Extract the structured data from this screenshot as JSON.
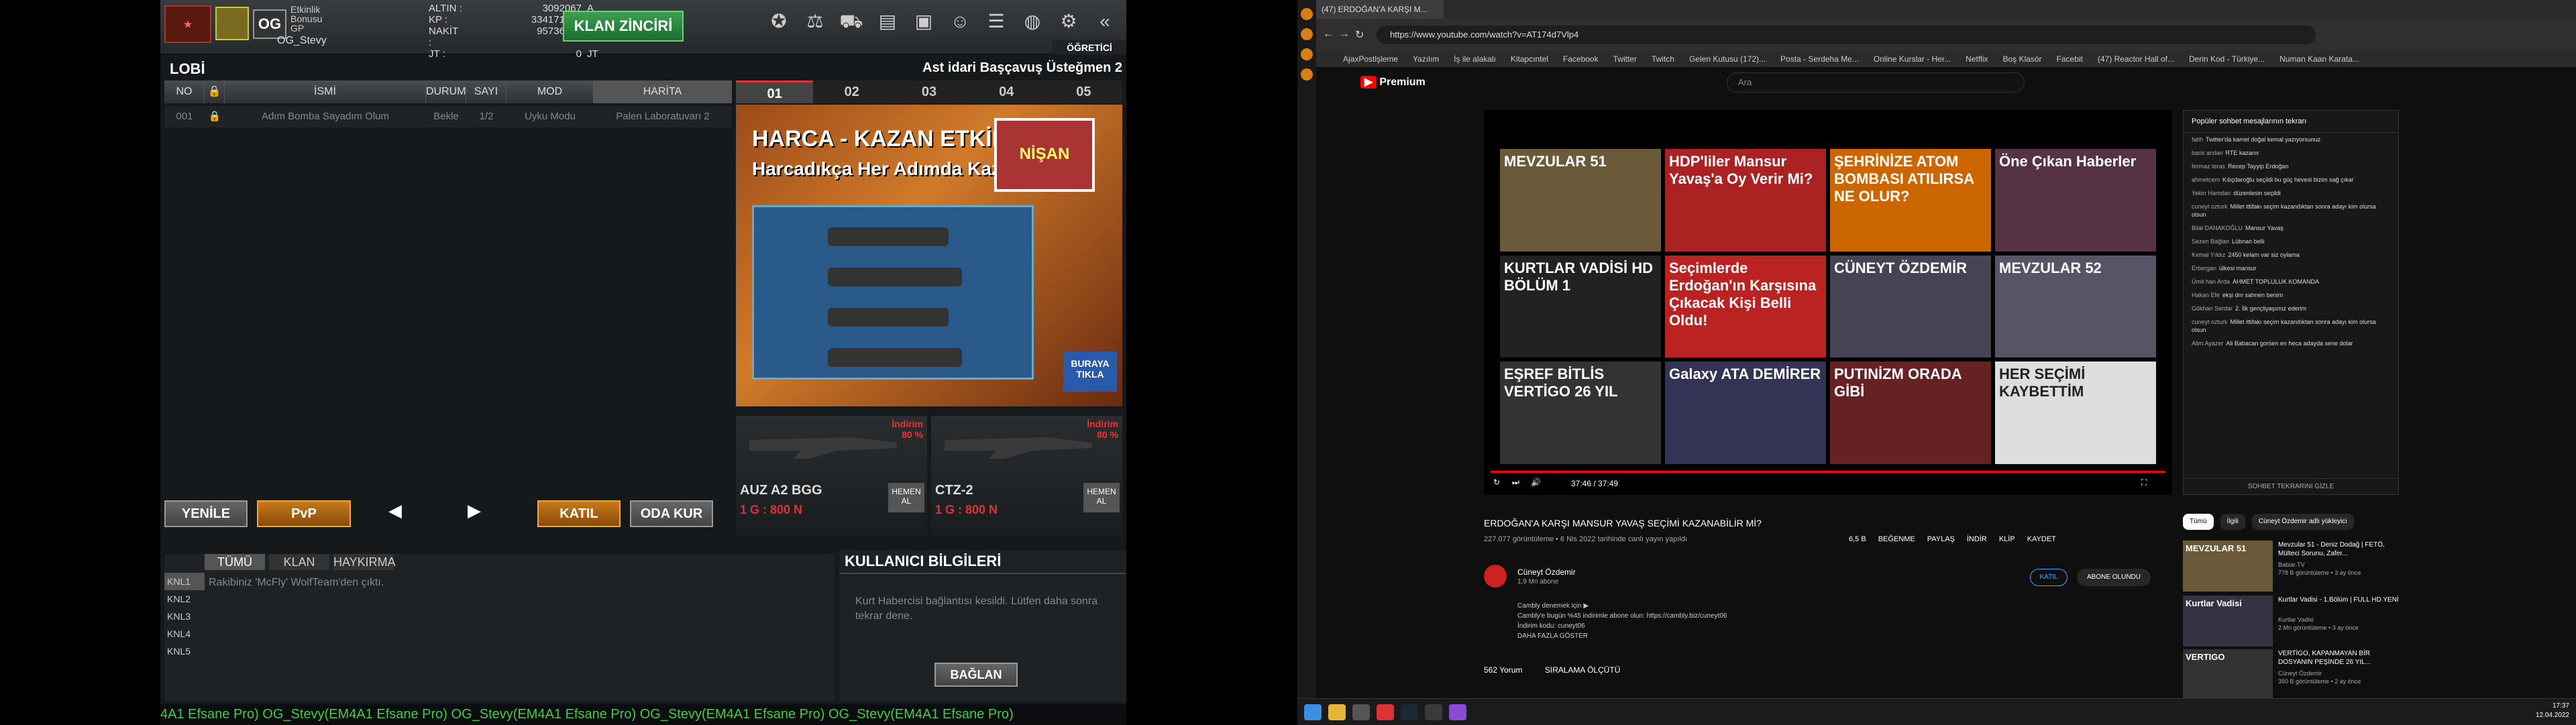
{
  "game": {
    "labels": {
      "etkinlik": "Etkinlik",
      "bonusu": "Bonusu",
      "gp": "GP"
    },
    "username": "OG_Stevy",
    "clan_tag": "OG",
    "stats": [
      {
        "k": "ALTIN :",
        "v": "3092067",
        "s": "A"
      },
      {
        "k": "KP :",
        "v": "334171579",
        "s": "KP"
      },
      {
        "k": "NAKİT :",
        "v": "95736702",
        "s": "N"
      },
      {
        "k": "JT :",
        "v": "0",
        "s": "JT"
      }
    ],
    "klan_button": "KLAN ZİNCİRİ",
    "ogretici": "ÖĞRETİCİ",
    "lobi": "LOBİ",
    "rank_name": "Ast idari Başçavuş Üsteğmen 2",
    "columns": [
      "NO",
      "",
      "İSMİ",
      "DURUM",
      "SAYI",
      "MOD",
      "HARİTA"
    ],
    "room": {
      "no": "001",
      "name": "Adım Bomba Sayadım Olum",
      "status": "Bekle",
      "count": "1/2",
      "mode": "Uyku Modu",
      "map": "Palen Laboratuvarı 2"
    },
    "tabs": [
      "01",
      "02",
      "03",
      "04",
      "05"
    ],
    "banner": {
      "title": "HARCA - KAZAN ETKİNLİĞİ",
      "subtitle": "Harcadıkça Her Adımda Kazan!",
      "badge": "NİŞAN",
      "tikla": "BURAYA TIKLA"
    },
    "weapons": [
      {
        "name": "AUZ A2 BGG",
        "price": "1 G : 800 N",
        "disc": "İndirim\n80 %",
        "hem": "HEMEN AL"
      },
      {
        "name": "CTZ-2",
        "price": "1 G : 800 N",
        "disc": "İndirim\n80 %",
        "hem": "HEMEN AL"
      }
    ],
    "buttons": {
      "yenile": "YENİLE",
      "pvp": "PvP",
      "katil": "KATIL",
      "oda": "ODA KUR"
    },
    "chat_tabs": [
      "TÜMÜ",
      "KLAN",
      "HAYKIRMA"
    ],
    "channels": [
      "KNL1",
      "KNL2",
      "KNL3",
      "KNL4",
      "KNL5"
    ],
    "chat_message": "Rakibiniz 'McFly' WolfTeam'den çıktı.",
    "userinfo": {
      "title": "KULLANICI BİLGİLERİ",
      "text": "Kurt Habercisi bağlantısı kesildi. Lütfen daha sonra tekrar dene.",
      "button": "BAĞLAN"
    },
    "ticker": "4A1 Efsane Pro)        OG_Stevy(EM4A1 Efsane Pro)        OG_Stevy(EM4A1 Efsane Pro)        OG_Stevy(EM4A1 Efsane Pro)        OG_Stevy(EM4A1 Efsane Pro)"
  },
  "browser": {
    "tab_title": "(47) ERDOĞAN'A KARŞI M...",
    "url": "https://www.youtube.com/watch?v=AT174d7Vlp4",
    "bookmarks": [
      "AjaxPostlşleme",
      "Yazılım",
      "İş ile alakalı",
      "Kitapcıntel",
      "Facebook",
      "Twitter",
      "Twitch",
      "Gelen Kutusu (172)...",
      "Posta - Serdeha Me...",
      "Online Kurslar - Her...",
      "Netflix",
      "Boş Klasör",
      "Facebit",
      "(47) Reactor Hall of...",
      "Derin Kod - Türkiye...",
      "Numan Kaan Karata..."
    ],
    "search_placeholder": "Ara",
    "logo": "Premium",
    "thumbs": [
      "MEVZULAR 51",
      "HDP'liler Mansur Yavaş'a Oy Verir Mi?",
      "ŞEHRİNİZE ATOM BOMBASI ATILIRSA NE OLUR?",
      "Öne Çıkan Haberler",
      "KURTLAR VADİSİ HD BÖLÜM 1",
      "Seçimlerde Erdoğan'ın Karşısına Çıkacak Kişi Belli Oldu!",
      "CÜNEYT ÖZDEMİR",
      "MEVZULAR 52",
      "EŞREF BİTLİS VERTİGO 26 YIL",
      "Galaxy ATA DEMİRER",
      "PUTINİZM ORADA GİBİ",
      "HER SEÇİMİ KAYBETTİM"
    ],
    "time": "37:46 / 37:49",
    "video_title": "ERDOĞAN'A KARŞI MANSUR YAVAŞ SEÇİMİ KAZANABİLİR Mİ?",
    "video_meta": "227.077 görüntüleme • 6 Nis 2022 tarihinde canlı yayın yapıldı",
    "actions": [
      "6,5 B",
      "BEĞENME",
      "PAYLAŞ",
      "İNDİR",
      "KLİP",
      "KAYDET"
    ],
    "channel": {
      "name": "Cüneyt Özdemir",
      "subs": "1,9 Mn abone",
      "desc": "Cambly denemek için ▶\nCambly'e bugün %45 indirimle abone olun: https://cambly.biz/cuneyt06\nİndirim kodu: cuneyt06\nDAHA FAZLA GÖSTER",
      "join": "KATIL",
      "subscribed": "ABONE OLUNDU"
    },
    "comments": "562 Yorum",
    "sort": "SIRALAMA ÖLÇÜTÜ",
    "chat_title": "Popüler sohbet mesajlarının tekrarı",
    "chat_msgs": [
      {
        "u": "fatih",
        "t": "Twitter'da kamel doğal kemal yazıyorsunuz"
      },
      {
        "u": "baris arslan",
        "t": "RTE kazanır"
      },
      {
        "u": "fermaz teras",
        "t": "Recep Tayyip Erdoğan"
      },
      {
        "u": "ahmetcem",
        "t": "Kılıçdaroğlu seçildi bu güç hevesi bizim sağ çıkar"
      },
      {
        "u": "Yekin Hamdan",
        "t": "düzenlesin seçildi"
      },
      {
        "u": "cuneyt ozturk",
        "t": "Millet ittifakı seçim kazandıktan sonra adayı kim olursa olsun"
      },
      {
        "u": "Bilal DANAKOĞLU",
        "t": "Mansur Yavaş"
      },
      {
        "u": "Sezen Bağlan",
        "t": "Lübnan belli"
      },
      {
        "u": "Kemal Yıldız",
        "t": "2450 kelam var siz oylama"
      },
      {
        "u": "Erbergan",
        "t": "ülkesi mansur"
      },
      {
        "u": "Ümit han Arda",
        "t": "AHMET TOPLULUK KOMANDA"
      },
      {
        "u": "Hakan Efe",
        "t": "ekşi dm sahnen benim"
      },
      {
        "u": "Gökhan Serdar",
        "t": "2. İlk gençliyaşımız ederim"
      },
      {
        "u": "cuneyt ozturk",
        "t": "Millet ittifakı seçim kazandıktan sonra adayı kim olursa olsun"
      },
      {
        "u": "Alim Ayazer",
        "t": "Ali Babacan gorsen en heca adayda sene dolar"
      }
    ],
    "chat_footer": "SOHBET TEKRARINI GİZLE",
    "filters": [
      "Tümü",
      "İlgili",
      "Cüneyt Özdemir adlı yükleyici"
    ],
    "recs": [
      {
        "thumb": "MEVZULAR 51",
        "title": "Mevzular 51 - Deniz Dodağ | FETÖ, Mülteci Sorunu, Zafer...",
        "ch": "Babiar.TV\n778 B görüntüleme • 3 ay önce"
      },
      {
        "thumb": "Kurtlar Vadisi",
        "title": "Kurtlar Vadisi - 1.Bölüm | FULL HD YENİ",
        "ch": "Kurtlar Vadisi\n2 Mn görüntüleme • 3 ay önce"
      },
      {
        "thumb": "VERTIGO",
        "title": "VERTİGO, KAPANMAYAN BİR DOSYANIN PEŞİNDE 26 YIL...",
        "ch": "Cüneyt Özdemir\n350 B görüntüleme • 2 ay önce"
      }
    ],
    "clock_time": "17:37",
    "clock_date": "12.04.2022"
  }
}
